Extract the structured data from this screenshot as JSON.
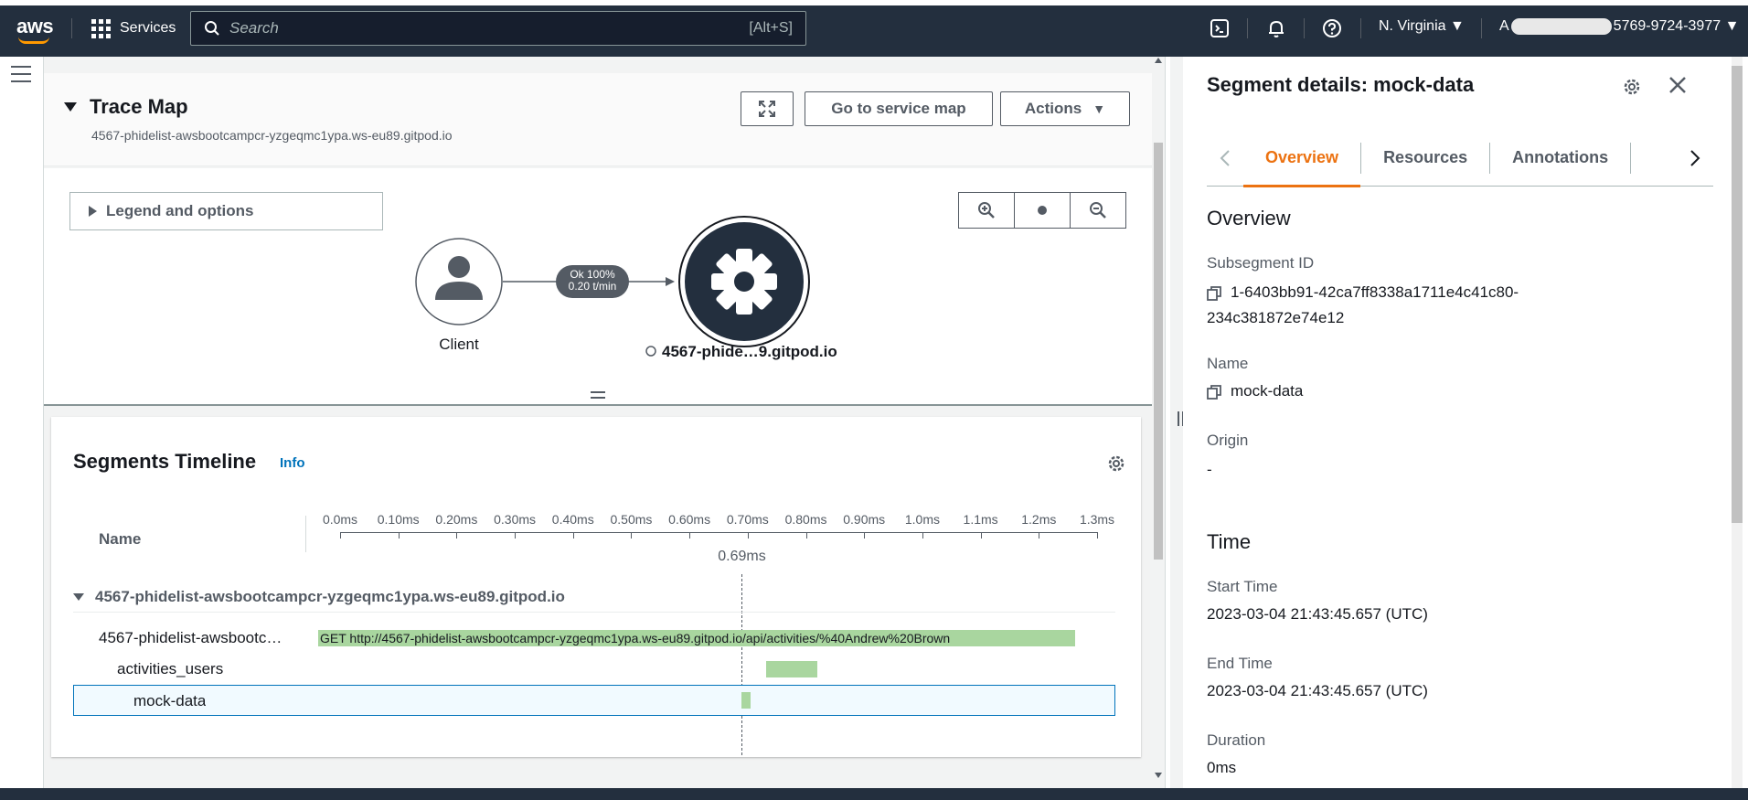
{
  "topbar": {
    "services_label": "Services",
    "search_placeholder": "Search",
    "search_shortcut": "[Alt+S]",
    "region": "N. Virginia",
    "account_prefix": "A",
    "account_suffix": "5769-9724-3977"
  },
  "trace_map": {
    "title": "Trace Map",
    "subtitle": "4567-phidelist-awsbootcampcr-yzgeqmc1ypa.ws-eu89.gitpod.io",
    "go_to_service_map": "Go to service map",
    "actions": "Actions",
    "legend": "Legend and options",
    "client_label": "Client",
    "edge_ok": "Ok 100%",
    "edge_rate": "0.20 t/min",
    "service_label": "4567-phide…9.gitpod.io"
  },
  "segments_timeline": {
    "title": "Segments Timeline",
    "info": "Info",
    "name_header": "Name",
    "ticks": [
      "0.0ms",
      "0.10ms",
      "0.20ms",
      "0.30ms",
      "0.40ms",
      "0.50ms",
      "0.60ms",
      "0.70ms",
      "0.80ms",
      "0.90ms",
      "1.0ms",
      "1.1ms",
      "1.2ms",
      "1.3ms"
    ],
    "cursor": "0.69ms",
    "group": "4567-phidelist-awsbootcampcr-yzgeqmc1ypa.ws-eu89.gitpod.io",
    "rows": [
      {
        "name": "4567-phidelist-awsbootc…",
        "bar_text": "GET http://4567-phidelist-awsbootcampcr-yzgeqmc1ypa.ws-eu89.gitpod.io/api/activities/%40Andrew%20Brown"
      },
      {
        "name": "activities_users",
        "bar_text": ""
      },
      {
        "name": "mock-data",
        "bar_text": ""
      }
    ]
  },
  "detail": {
    "title": "Segment details: mock-data",
    "tabs": [
      "Overview",
      "Resources",
      "Annotations"
    ],
    "overview_heading": "Overview",
    "subsegment_id_label": "Subsegment ID",
    "subsegment_id_line1": "1-6403bb91-42ca7ff8338a1711e4c41c80-",
    "subsegment_id_line2": "234c381872e74e12",
    "name_label": "Name",
    "name_value": "mock-data",
    "origin_label": "Origin",
    "origin_value": "-",
    "time_heading": "Time",
    "start_label": "Start Time",
    "start_value": "2023-03-04 21:43:45.657 (UTC)",
    "end_label": "End Time",
    "end_value": "2023-03-04 21:43:45.657 (UTC)",
    "duration_label": "Duration",
    "duration_value": "0ms"
  },
  "colors": {
    "topbar": "#232f3e",
    "accent": "#ec7211",
    "link": "#0073bb",
    "bar": "#a9d69f"
  }
}
